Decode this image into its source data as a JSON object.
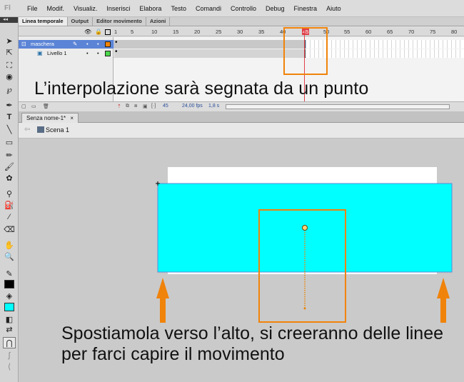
{
  "app": {
    "logo": "Fl"
  },
  "menu": [
    "File",
    "Modif.",
    "Visualiz.",
    "Inserisci",
    "Elabora",
    "Testo",
    "Comandi",
    "Controllo",
    "Debug",
    "Finestra",
    "Aiuto"
  ],
  "timeline": {
    "tabs": [
      "Linea temporale",
      "Output",
      "Editor movimento",
      "Azioni"
    ],
    "ruler": [
      "1",
      "5",
      "10",
      "15",
      "20",
      "25",
      "30",
      "35",
      "40",
      "45",
      "50",
      "55",
      "60",
      "65",
      "70",
      "75",
      "80"
    ],
    "layers": [
      {
        "name": "maschera",
        "selected": true
      },
      {
        "name": "Livello 1",
        "selected": false
      }
    ],
    "footer": {
      "frame": "45",
      "fps": "24,00 fps",
      "time": "1,8 s"
    }
  },
  "document": {
    "tab": "Senza nome-1*",
    "scene": "Scena 1"
  },
  "annotations": {
    "top": "L’interpolazione sarà segnata da un punto",
    "bottom": "Spostiamola verso l’alto, si creeranno delle linee per farci capire il movimento"
  },
  "colors": {
    "mask_shape": "#00ffff",
    "stage": "#ffffff",
    "highlight": "#f0830a",
    "playhead": "#e0404a",
    "selected_layer": "#5b84d6"
  }
}
